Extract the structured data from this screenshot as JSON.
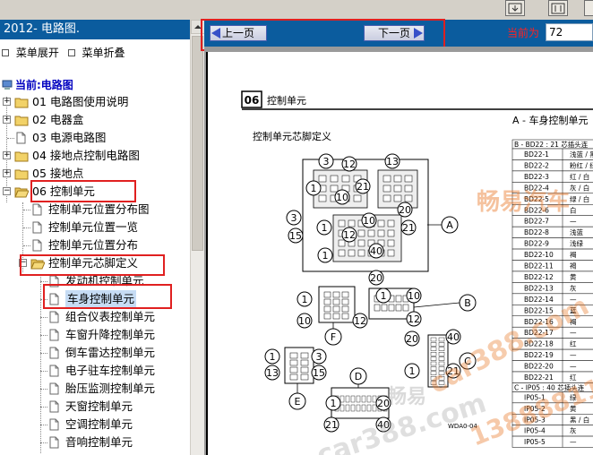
{
  "window": {
    "left_title": "2012- 电路图.",
    "menu_expand": "菜单展开",
    "menu_collapse": "菜单折叠",
    "current_label": "当前:电路图"
  },
  "tree": [
    {
      "label": "01 电路图使用说明",
      "type": "folder"
    },
    {
      "label": "02 电器盒",
      "type": "folder"
    },
    {
      "label": "03 电源电路图",
      "type": "doc"
    },
    {
      "label": "04 接地点控制电路图",
      "type": "folder"
    },
    {
      "label": "05 接地点",
      "type": "folder"
    },
    {
      "label": "06 控制单元",
      "type": "folder-open"
    },
    {
      "label": "控制单元位置分布图",
      "type": "doc"
    },
    {
      "label": "控制单元位置一览",
      "type": "doc"
    },
    {
      "label": "控制单元位置分布",
      "type": "doc"
    },
    {
      "label": "控制单元芯脚定义",
      "type": "folder-open"
    },
    {
      "label": "发动机控制单元",
      "type": "doc"
    },
    {
      "label": "车身控制单元",
      "type": "doc",
      "selected": true
    },
    {
      "label": "组合仪表控制单元",
      "type": "doc"
    },
    {
      "label": "车窗升降控制单元",
      "type": "doc"
    },
    {
      "label": "倒车雷达控制单元",
      "type": "doc"
    },
    {
      "label": "电子驻车控制单元",
      "type": "doc"
    },
    {
      "label": "胎压监测控制单元",
      "type": "doc"
    },
    {
      "label": "天窗控制单元",
      "type": "doc"
    },
    {
      "label": "空调控制单元",
      "type": "doc"
    },
    {
      "label": "音响控制单元",
      "type": "doc"
    }
  ],
  "nav": {
    "prev_label": "上一页",
    "next_label": "下一页",
    "page_label": "当前为",
    "page_value": "72"
  },
  "doc": {
    "section_num": "06",
    "section_title": "控制单元",
    "pinout_title": "控制单元芯脚定义",
    "right_title": "A - 车身控制单元",
    "table_header_b": "B - BD22 : 21 芯插头连",
    "table_header_c": "C - IP05 : 40 芯插头连",
    "drawing_code": "WDA0-04",
    "b_rows": [
      {
        "pin": "BD22-1",
        "color": "浅蓝 / 黑"
      },
      {
        "pin": "BD22-2",
        "color": "粉红 / 绿"
      },
      {
        "pin": "BD22-3",
        "color": "红 / 白"
      },
      {
        "pin": "BD22-4",
        "color": "灰 / 白"
      },
      {
        "pin": "BD22-5",
        "color": "绿 / 白"
      },
      {
        "pin": "BD22-6",
        "color": "白"
      },
      {
        "pin": "BD22-7",
        "color": "—"
      },
      {
        "pin": "BD22-8",
        "color": "浅蓝"
      },
      {
        "pin": "BD22-9",
        "color": "浅绿"
      },
      {
        "pin": "BD22-10",
        "color": "褐"
      },
      {
        "pin": "BD22-11",
        "color": "褐"
      },
      {
        "pin": "BD22-12",
        "color": "黄"
      },
      {
        "pin": "BD22-13",
        "color": "灰"
      },
      {
        "pin": "BD22-14",
        "color": "—"
      },
      {
        "pin": "BD22-15",
        "color": "蓝"
      },
      {
        "pin": "BD22-16",
        "color": "褐"
      },
      {
        "pin": "BD22-17",
        "color": "—"
      },
      {
        "pin": "BD22-18",
        "color": "红"
      },
      {
        "pin": "BD22-19",
        "color": "—"
      },
      {
        "pin": "BD22-20",
        "color": "—"
      },
      {
        "pin": "BD22-21",
        "color": "红"
      }
    ],
    "c_rows": [
      {
        "pin": "IP05-1",
        "color": "绿"
      },
      {
        "pin": "IP05-2",
        "color": "黄"
      },
      {
        "pin": "IP05-3",
        "color": "黑 / 白"
      },
      {
        "pin": "IP05-4",
        "color": "灰"
      },
      {
        "pin": "IP05-5",
        "color": "—"
      }
    ],
    "connectors": {
      "A": [
        "3",
        "10",
        "1",
        "12",
        "21",
        "13",
        "20",
        "3",
        "15",
        "1",
        "12",
        "10",
        "21",
        "40",
        "1",
        "20"
      ],
      "B": [
        "1",
        "10",
        "12",
        "B"
      ],
      "C": [
        "20",
        "40",
        "1",
        "21",
        "C"
      ],
      "D": [
        "1",
        "21",
        "20",
        "40",
        "D"
      ],
      "E": [
        "1",
        "3",
        "13",
        "15",
        "E"
      ],
      "F": [
        "1",
        "10",
        "12",
        "F"
      ]
    }
  },
  "watermarks": {
    "brand": "畅易汽车",
    "site": "car388.com",
    "small": "畅易",
    "phone": "138888115"
  },
  "colors": {
    "title_bar": "#0b5c9e",
    "highlight": "#e02020",
    "watermark": "#e87828",
    "selected_bg": "#c6dcf4"
  }
}
